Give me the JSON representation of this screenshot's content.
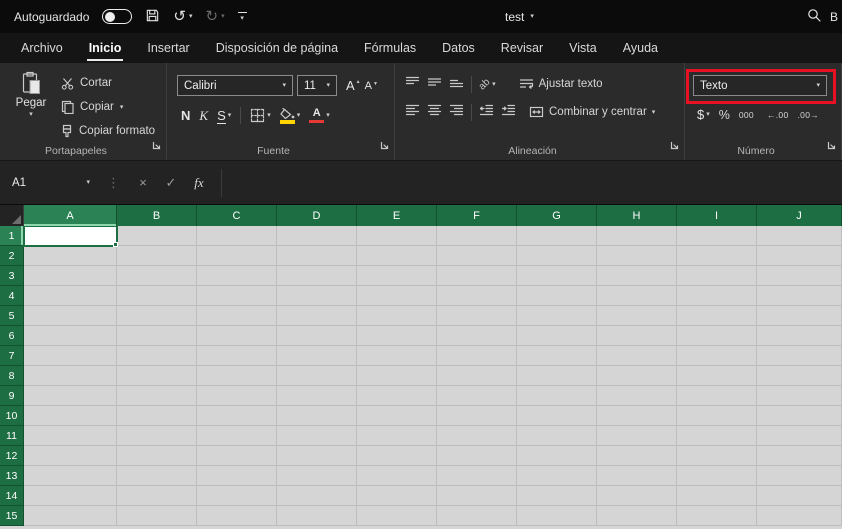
{
  "title_bar": {
    "autosave_label": "Autoguardado",
    "autosave_state": "off",
    "document_title": "test",
    "search_label": "B"
  },
  "menu": {
    "tabs": [
      {
        "label": "Archivo",
        "active": false
      },
      {
        "label": "Inicio",
        "active": true
      },
      {
        "label": "Insertar",
        "active": false
      },
      {
        "label": "Disposición de página",
        "active": false
      },
      {
        "label": "Fórmulas",
        "active": false
      },
      {
        "label": "Datos",
        "active": false
      },
      {
        "label": "Revisar",
        "active": false
      },
      {
        "label": "Vista",
        "active": false
      },
      {
        "label": "Ayuda",
        "active": false
      }
    ]
  },
  "ribbon": {
    "clipboard_group": {
      "label": "Portapapeles",
      "paste_label": "Pegar",
      "cut_label": "Cortar",
      "copy_label": "Copiar",
      "format_painter_label": "Copiar formato"
    },
    "font_group": {
      "label": "Fuente",
      "font_name": "Calibri",
      "font_size": "11",
      "bold_label": "N",
      "italic_label": "K",
      "underline_label": "S"
    },
    "alignment_group": {
      "label": "Alineación",
      "wrap_text_label": "Ajustar texto",
      "merge_center_label": "Combinar y centrar"
    },
    "number_group": {
      "label": "Número",
      "number_format_value": "Texto",
      "currency_label": "$",
      "percent_label": "%",
      "thousands_label": "000"
    }
  },
  "formula_bar": {
    "name_box_value": "A1",
    "cancel_glyph": "×",
    "enter_glyph": "✓",
    "fx_label": "fx",
    "formula_value": ""
  },
  "grid": {
    "columns": [
      "A",
      "B",
      "C",
      "D",
      "E",
      "F",
      "G",
      "H",
      "I",
      "J"
    ],
    "rows": [
      "1",
      "2",
      "3",
      "4",
      "5",
      "6",
      "7",
      "8",
      "9",
      "10",
      "11",
      "12",
      "13",
      "14",
      "15"
    ],
    "selected_cell": "A1",
    "selected_column": "A",
    "selected_row": "1"
  },
  "icons": {
    "chevron_down": "▾",
    "undo": "↺",
    "redo": "↻",
    "ellipsis_vertical": "⋮",
    "letter_a": "A",
    "orientation_ab": "ab",
    "increase_decimal": "←.00",
    "decrease_decimal": ".00→"
  },
  "colors": {
    "header_green": "#1e6e44",
    "header_green_selected": "#2b8255",
    "selection_border": "#1e6e44",
    "cell_bg": "#d5d5d5",
    "annotation_red": "#e81123",
    "fill_yellow": "#ffd400",
    "font_red": "#e53935",
    "active_tab_underline": "#eaeaea"
  }
}
